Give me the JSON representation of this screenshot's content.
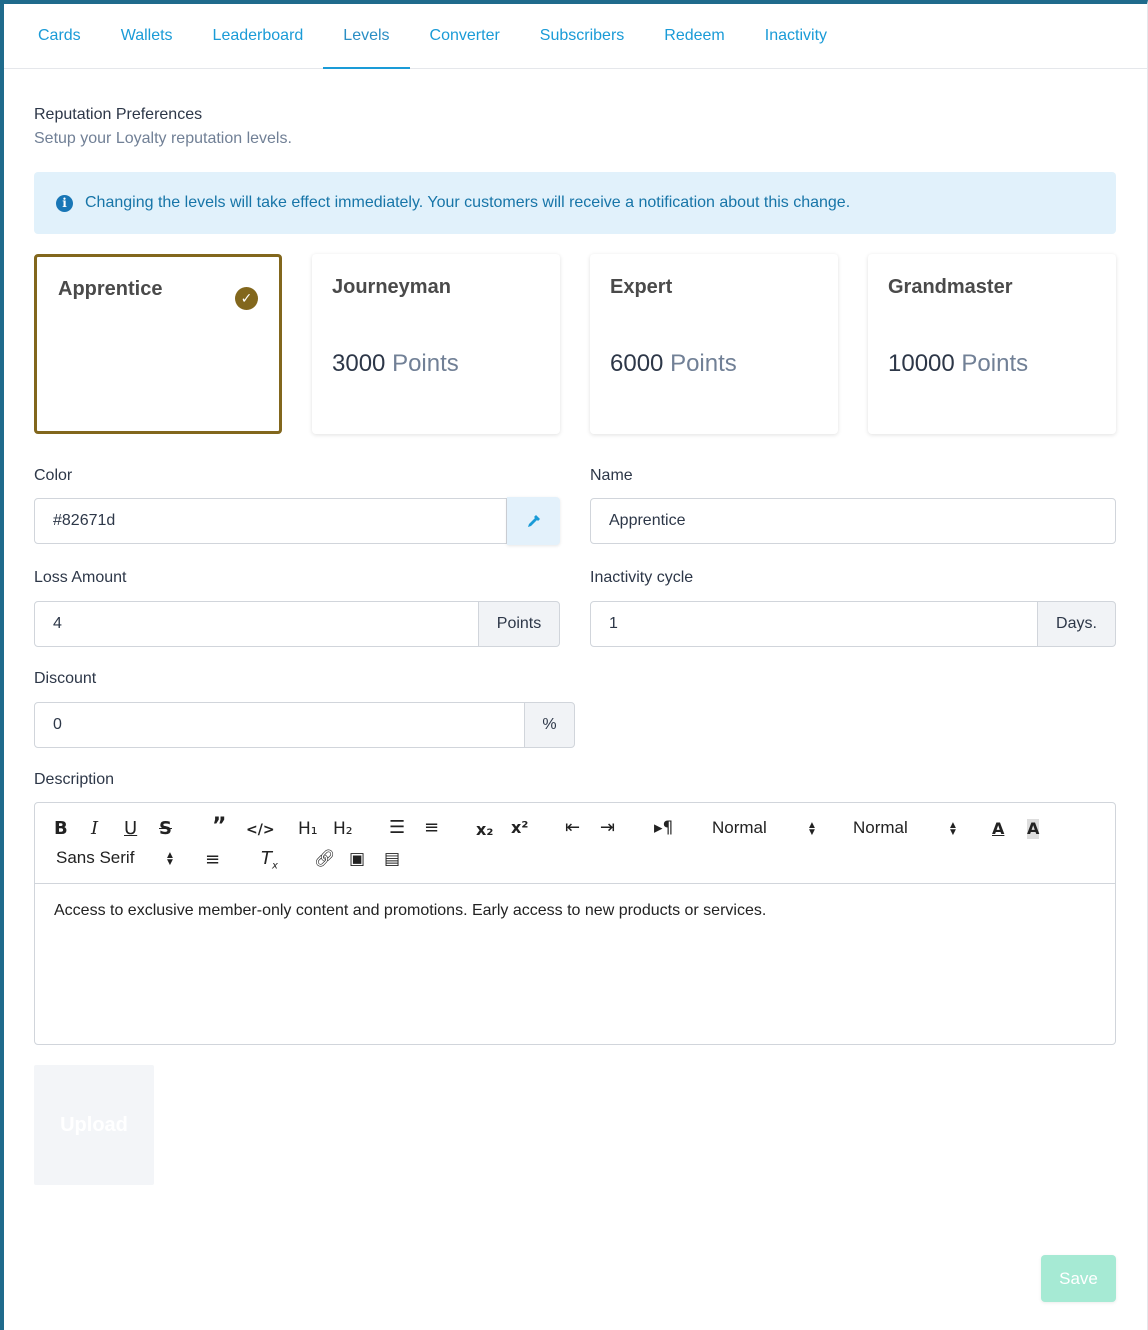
{
  "tabs": [
    {
      "label": "Cards"
    },
    {
      "label": "Wallets"
    },
    {
      "label": "Leaderboard"
    },
    {
      "label": "Levels"
    },
    {
      "label": "Converter"
    },
    {
      "label": "Subscribers"
    },
    {
      "label": "Redeem"
    },
    {
      "label": "Inactivity"
    }
  ],
  "active_tab": "Levels",
  "header": {
    "title": "Reputation Preferences",
    "subtitle": "Setup your Loyalty reputation levels."
  },
  "alert": {
    "icon": "info-icon",
    "text": "Changing the levels will take effect immediately. Your customers will receive a notification about this change."
  },
  "levels": [
    {
      "name": "Apprentice",
      "points": "",
      "unit": "",
      "selected": true
    },
    {
      "name": "Journeyman",
      "points": "3000",
      "unit": "Points",
      "selected": false
    },
    {
      "name": "Expert",
      "points": "6000",
      "unit": "Points",
      "selected": false
    },
    {
      "name": "Grandmaster",
      "points": "10000",
      "unit": "Points",
      "selected": false
    }
  ],
  "form": {
    "color_label": "Color",
    "color_value": "#82671d",
    "name_label": "Name",
    "name_value": "Apprentice",
    "loss_label": "Loss Amount",
    "loss_value": "4",
    "loss_unit": "Points",
    "inactivity_label": "Inactivity cycle",
    "inactivity_value": "1",
    "inactivity_unit": "Days.",
    "discount_label": "Discount",
    "discount_value": "0",
    "discount_unit": "%",
    "description_label": "Description"
  },
  "editor": {
    "header_select": "Normal",
    "size_select": "Normal",
    "font_select": "Sans Serif",
    "content": "Access to exclusive member-only content and promotions. Early access to new products or services."
  },
  "buttons": {
    "upload": "Upload",
    "save": "Save"
  },
  "colors": {
    "accent": "#1a9bd7",
    "selected_level": "#82671d",
    "save": "#a6ead4",
    "alert_bg": "#e1f1fb"
  }
}
